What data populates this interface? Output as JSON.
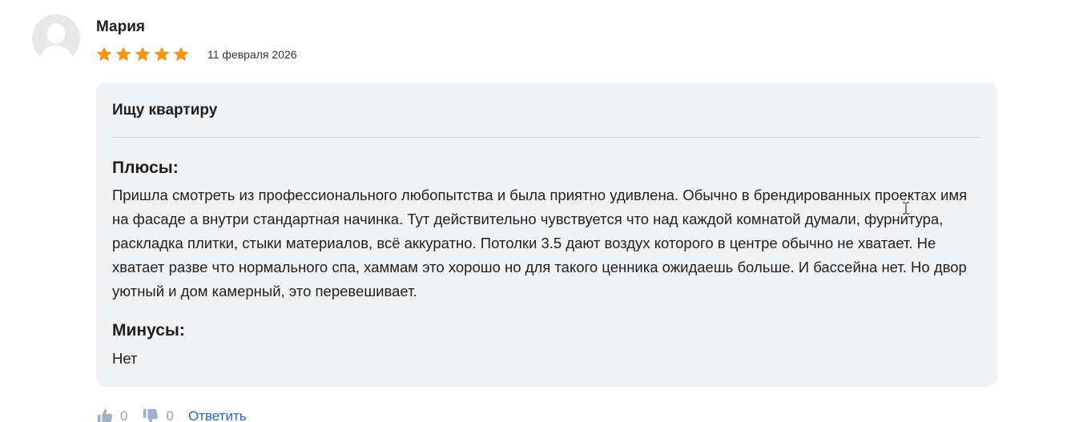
{
  "review": {
    "author": "Мария",
    "rating": 5,
    "rating_max": 5,
    "date": "11 февраля 2026",
    "title": "Ищу квартиру",
    "pros_heading": "Плюсы:",
    "pros_text": "Пришла смотреть из профессионального любопытства и была приятно удивлена. Обычно в брендированных проектах имя на фасаде а внутри стандартная начинка. Тут действительно чувствуется что над каждой комнатой думали, фурнитура, раскладка плитки, стыки материалов, всё аккуратно. Потолки 3.5 дают воздух которого в центре обычно не хватает. Не хватает разве что нормального спа, хаммам это хорошо но для такого ценника ожидаешь больше. И бассейна нет. Но двор уютный и дом камерный, это перевешивает.",
    "cons_heading": "Минусы:",
    "cons_text": "Нет"
  },
  "actions": {
    "likes": "0",
    "dislikes": "0",
    "reply_label": "Ответить"
  },
  "icons": {
    "avatar": "user-avatar-icon",
    "star": "star-icon",
    "like": "thumbs-up-icon",
    "dislike": "thumbs-down-icon",
    "cursor": "text-cursor-icon"
  },
  "colors": {
    "star": "#f7941d",
    "card_background": "#f2f3f5",
    "link": "#2a62c9",
    "muted": "#9aa0a8"
  }
}
